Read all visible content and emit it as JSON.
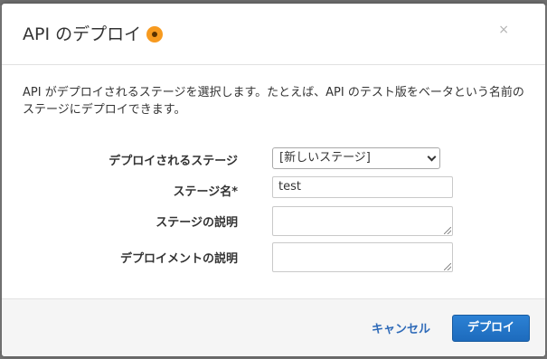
{
  "dialog": {
    "title": "API のデプロイ",
    "info_icon": "info-icon",
    "close_label": "×",
    "description": "API がデプロイされるステージを選択します。たとえば、API のテスト版をベータという名前のステージにデプロイできます。"
  },
  "form": {
    "deploy_stage": {
      "label": "デプロイされるステージ",
      "selected": "[新しいステージ]"
    },
    "stage_name": {
      "label": "ステージ名*",
      "value": "test"
    },
    "stage_description": {
      "label": "ステージの説明",
      "value": ""
    },
    "deployment_description": {
      "label": "デプロイメントの説明",
      "value": ""
    }
  },
  "footer": {
    "cancel_label": "キャンセル",
    "deploy_label": "デプロイ"
  },
  "colors": {
    "accent_orange": "#f79a1f",
    "primary_blue": "#1d6bbd",
    "link_blue": "#2e6ab8"
  }
}
